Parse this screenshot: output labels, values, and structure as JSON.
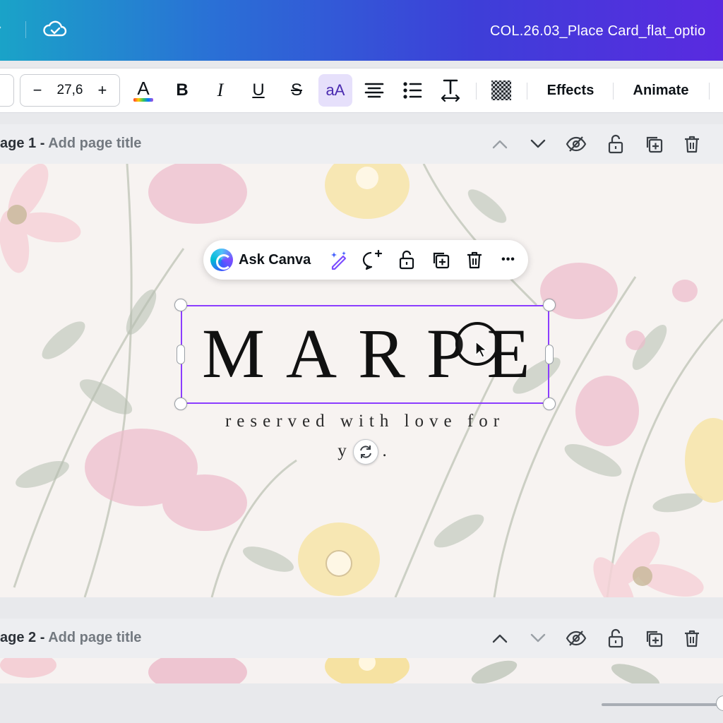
{
  "header": {
    "doc_title": "COL.26.03_Place Card_flat_optio"
  },
  "toolbar": {
    "font_size": "27,6",
    "decrease": "−",
    "increase": "+",
    "effects_label": "Effects",
    "animate_label": "Animate",
    "text_color_glyph": "A",
    "bold_glyph": "B",
    "italic_glyph": "I",
    "underline_glyph": "U",
    "strike_glyph": "S",
    "case_glyph": "aA"
  },
  "pages": [
    {
      "prefix": "age 1 - ",
      "title_placeholder": "Add page title"
    },
    {
      "prefix": "age 2 - ",
      "title_placeholder": "Add page title"
    }
  ],
  "float_toolbar": {
    "ask_label": "Ask Canva",
    "more_glyph": "•••"
  },
  "design": {
    "name_text": "MARPE",
    "sub_line1": "reserved with love for",
    "sub_line2": "y   ."
  },
  "colors": {
    "selection": "#8b3dff",
    "header_gradient_start": "#1aa3c8",
    "header_gradient_end": "#5a2ae0",
    "active_case_bg": "#e6e0fb"
  }
}
